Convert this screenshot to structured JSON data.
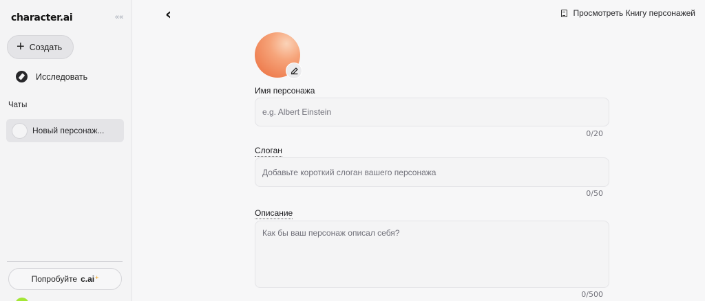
{
  "sidebar": {
    "logo": "character.ai",
    "collapse_icon": "««",
    "create_label": "Создать",
    "explore_label": "Исследовать",
    "chats_title": "Чаты",
    "chats": [
      {
        "name": "Новый персонаж..."
      }
    ],
    "try_label": "Попробуйте",
    "try_brand": "c.ai",
    "try_spark": "+"
  },
  "header": {
    "back_icon": "‹",
    "book_link": "Просмотреть Книгу персонажей"
  },
  "form": {
    "name_label": "Имя персонажа",
    "name_placeholder": "e.g. Albert Einstein",
    "name_value": "",
    "name_counter": "0/20",
    "tagline_label": "Слоган",
    "tagline_placeholder": "Добавьте короткий слоган вашего персонажа",
    "tagline_value": "",
    "tagline_counter": "0/50",
    "description_label": "Описание",
    "description_placeholder": "Как бы ваш персонаж описал себя?",
    "description_value": "",
    "description_counter": "0/500"
  },
  "colors": {
    "accent_avatar_start": "#fbd3b8",
    "accent_avatar_end": "#ee7d4f",
    "spark": "#f59e0b",
    "user_avatar": "#a3e635"
  }
}
